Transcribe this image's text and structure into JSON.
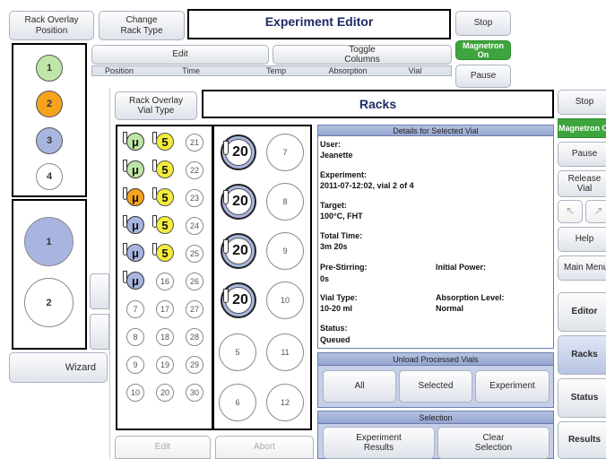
{
  "back": {
    "rack_overlay_position": "Rack Overlay\nPosition",
    "change_rack_type": "Change\nRack Type",
    "title": "Experiment Editor",
    "stop": "Stop",
    "magnetron": "Magnetron On",
    "pause": "Pause",
    "edit": "Edit",
    "toggle_columns": "Toggle\nColumns",
    "columns": [
      "Position",
      "Time",
      "Temp",
      "Absorption",
      "Vial"
    ],
    "rack_circles": [
      "1",
      "2",
      "3",
      "4"
    ],
    "big_circles": [
      "1",
      "2"
    ],
    "wizard": "Wizard"
  },
  "dialog": {
    "rack_overlay_vial_type": "Rack Overlay\nVial Type",
    "title": "Racks",
    "small_marked": [
      "μ",
      "μ",
      "μ",
      "μ",
      "μ",
      "μ"
    ],
    "five_label": "5",
    "small_vials": [
      "21",
      "22",
      "23",
      "24",
      "25",
      "16",
      "26",
      "7",
      "17",
      "27",
      "8",
      "18",
      "28",
      "9",
      "19",
      "29",
      "10",
      "20",
      "30"
    ],
    "big_marked": [
      "20",
      "20",
      "20",
      "20"
    ],
    "big_vials": [
      "7",
      "8",
      "9",
      "10",
      "5",
      "11",
      "6",
      "12"
    ],
    "edit": "Edit",
    "abort": "Abort"
  },
  "details": {
    "header": "Details for Selected Vial",
    "user_label": "User:",
    "user": "Jeanette",
    "experiment_label": "Experiment:",
    "experiment": "2011-07-12:02, vial 2 of 4",
    "target_label": "Target:",
    "target": "100°C, FHT",
    "total_time_label": "Total Time:",
    "total_time": "3m 20s",
    "pre_stirring_label": "Pre-Stirring:",
    "pre_stirring": "0s",
    "initial_power_label": "Initial Power:",
    "vial_type_label": "Vial Type:",
    "vial_type": "10-20 ml",
    "absorption_label": "Absorption Level:",
    "absorption": "Normal",
    "status_label": "Status:",
    "status": "Queued"
  },
  "unload": {
    "header": "Unload Processed Vials",
    "all": "All",
    "selected": "Selected",
    "experiment": "Experiment"
  },
  "selection": {
    "header": "Selection",
    "experiment_results": "Experiment\nResults",
    "clear_selection": "Clear\nSelection"
  },
  "sidebar": {
    "stop": "Stop",
    "magnetron": "Magnetron On",
    "pause": "Pause",
    "release_vial": "Release\nVial",
    "help": "Help",
    "main_menu": "Main Menu",
    "editor": "Editor",
    "racks": "Racks",
    "status": "Status",
    "results": "Results"
  },
  "colors": {
    "green": "#3ea43e",
    "orange": "#f5a21c",
    "blue": "#a8b5e0",
    "light_green": "#bfe6a8",
    "yellow": "#f3ec3a",
    "navy": "#1f2a66"
  }
}
